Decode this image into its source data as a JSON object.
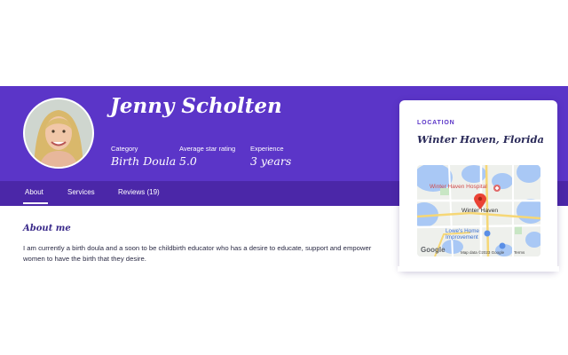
{
  "profile": {
    "name": "Jenny Scholten",
    "stats": [
      {
        "label": "Category",
        "value": "Birth Doula"
      },
      {
        "label": "Average star rating",
        "value": "5.0"
      },
      {
        "label": "Experience",
        "value": "3 years"
      }
    ]
  },
  "tabs": [
    {
      "label": "About",
      "active": true
    },
    {
      "label": "Services",
      "active": false
    },
    {
      "label": "Reviews (19)",
      "active": false
    }
  ],
  "about": {
    "title": "About me",
    "text": "I am currently a birth doula and a soon to be childbirth educator who has a desire to educate, support and empower women to have the birth that they desire."
  },
  "location": {
    "label": "LOCATION",
    "value": "Winter Haven, Florida",
    "map": {
      "places": [
        "Winter Haven Hospital",
        "Winter Haven",
        "Lowe's Home Improvement"
      ],
      "logo": "Google",
      "attribution": "Map data ©2023 Google",
      "terms": "Terms"
    }
  },
  "colors": {
    "hero": "#5b35c8",
    "tabbar": "#4b27a8",
    "accent": "#5b35c8",
    "water": "#a9c8f5",
    "pin": "#ea4335"
  }
}
